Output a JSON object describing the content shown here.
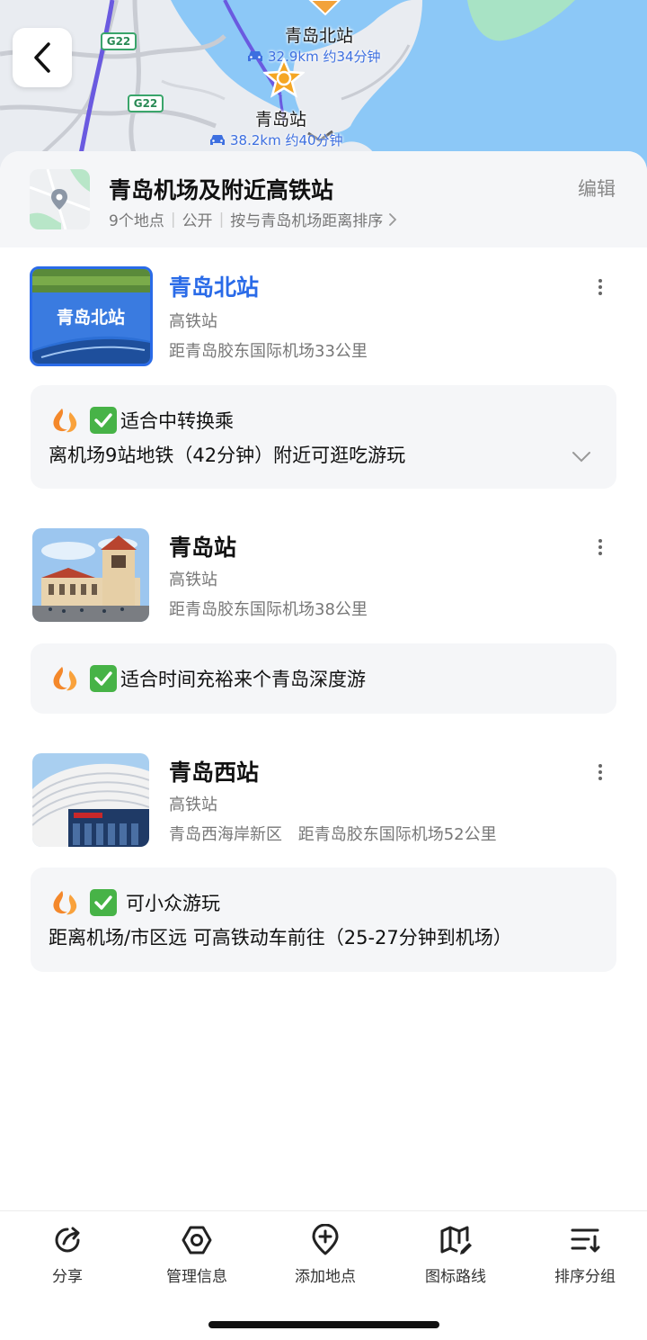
{
  "map": {
    "stations": [
      {
        "name": "青岛北站",
        "route": "32.9km 约34分钟"
      },
      {
        "name": "青岛站",
        "route": "38.2km 约40分钟"
      }
    ],
    "road_shields": [
      "G22",
      "G22"
    ]
  },
  "list": {
    "title": "青岛机场及附近高铁站",
    "meta": {
      "count": "9个地点",
      "visibility": "公开",
      "sort": "按与青岛机场距离排序"
    },
    "edit_label": "编辑"
  },
  "places": [
    {
      "name": "青岛北站",
      "image_text": "青岛北站",
      "type": "高铁站",
      "distance": "距青岛胶东国际机场33公里",
      "note_title": "适合中转换乘",
      "note_body": "离机场9站地铁（42分钟）附近可逛吃游玩"
    },
    {
      "name": "青岛站",
      "type": "高铁站",
      "distance": "距青岛胶东国际机场38公里",
      "note_title": "适合时间充裕来个青岛深度游"
    },
    {
      "name": "青岛西站",
      "type": "高铁站",
      "area": "青岛西海岸新区",
      "distance": "距青岛胶东国际机场52公里",
      "note_title": "可小众游玩",
      "note_body": "距离机场/市区远 可高铁动车前往（25-27分钟到机场）"
    }
  ],
  "toolbar": {
    "items": [
      {
        "label": "分享",
        "icon": "share-icon"
      },
      {
        "label": "管理信息",
        "icon": "hexagon-settings-icon"
      },
      {
        "label": "添加地点",
        "icon": "add-location-icon"
      },
      {
        "label": "图标路线",
        "icon": "map-route-icon"
      },
      {
        "label": "排序分组",
        "icon": "sort-list-icon"
      }
    ]
  },
  "colors": {
    "accent": "#2a6be8",
    "sea": "#8cc8f7",
    "note_bg": "#f5f6f8",
    "check": "#47b347",
    "flame": "#f4882b"
  }
}
